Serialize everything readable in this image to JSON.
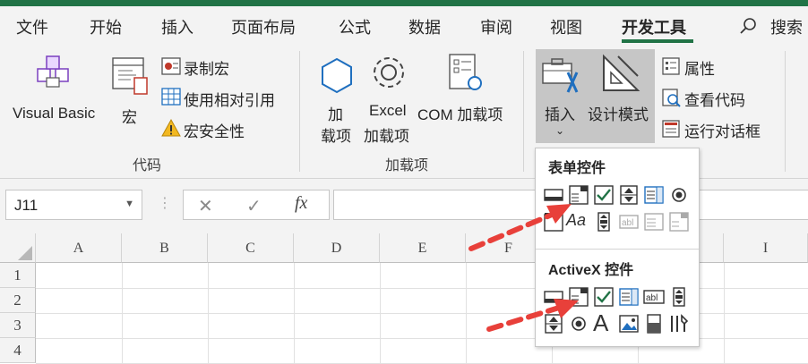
{
  "tabs": [
    "文件",
    "开始",
    "插入",
    "页面布局",
    "公式",
    "数据",
    "审阅",
    "视图",
    "开发工具"
  ],
  "search_label": "搜索",
  "ribbon": {
    "code_group": {
      "visual_basic": "Visual Basic",
      "macros": "宏",
      "record_macro": "录制宏",
      "relative_refs": "使用相对引用",
      "macro_security": "宏安全性",
      "group_label": "代码"
    },
    "addins_group": {
      "addins_line1": "加",
      "addins_line2": "载项",
      "excel_addins_line1": "Excel",
      "excel_addins_line2": "加载项",
      "com_addins": "COM 加载项",
      "group_label": "加载项"
    },
    "controls_group": {
      "insert": "插入",
      "design_mode": "设计模式",
      "properties": "属性",
      "view_code": "查看代码",
      "run_dialog": "运行对话框"
    }
  },
  "formula_bar": {
    "name_box": "J11",
    "cancel_symbol": "✕",
    "enter_symbol": "✓",
    "fx_symbol": "fx"
  },
  "columns": [
    "A",
    "B",
    "C",
    "D",
    "E",
    "F",
    "I"
  ],
  "rows": [
    "1",
    "2",
    "3",
    "4"
  ],
  "dropdown": {
    "form_controls_title": "表单控件",
    "activex_title": "ActiveX 控件"
  },
  "colors": {
    "accent": "#217346",
    "arrow": "#e8403a",
    "check": "#217346"
  }
}
